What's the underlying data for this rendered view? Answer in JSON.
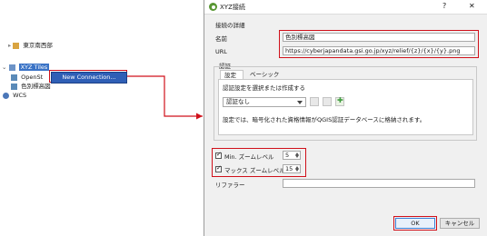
{
  "tree": {
    "items": [
      {
        "label": "東京南西部"
      },
      {
        "label": "XYZ Tiles"
      },
      {
        "label": "OpenSt"
      },
      {
        "label": "色別標高図"
      },
      {
        "label": "WCS"
      }
    ]
  },
  "context_menu": {
    "new_connection": "New Connection..."
  },
  "dialog": {
    "title": "XYZ接続",
    "help_button": "?",
    "close_button": "✕",
    "connection_details_title": "接続の詳細",
    "name_label": "名前",
    "name_value": "色別標高図",
    "url_label": "URL",
    "url_value": "https://cyberjapandata.gsi.go.jp/xyz/relief/{z}/{x}/{y}.png",
    "auth_group_title": "認証",
    "tabs": [
      "設定",
      "ベーシック"
    ],
    "auth_select_label": "認証設定を選択または作成する",
    "auth_combo_value": "認証なし",
    "auth_info_text": "設定では、暗号化された資格情報がQGIS認証データベースに格納されます。",
    "min_zoom_label": "Min. ズームレベル",
    "min_zoom_value": "5",
    "max_zoom_label": "マックス ズームレベル",
    "max_zoom_value": "15",
    "referer_label": "リファラー",
    "referer_value": "",
    "ok_button": "OK",
    "cancel_button": "キャンセル"
  },
  "colors": {
    "highlight_red": "#d0101a",
    "selection_blue": "#2f5fb6",
    "qgis_green": "#589632"
  }
}
